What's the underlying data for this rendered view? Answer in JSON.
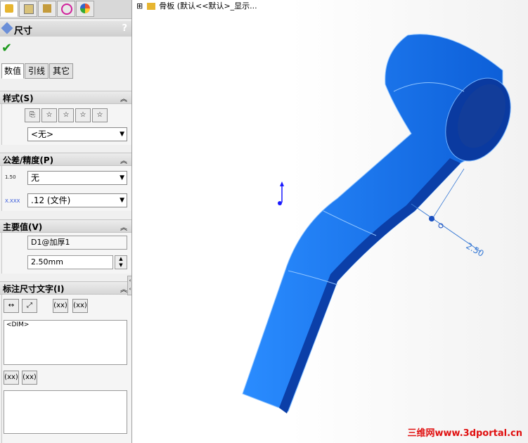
{
  "tree": {
    "expand": "⊞",
    "label": "骨板  (默认<<默认>_显示..."
  },
  "panel": {
    "title": "尺寸",
    "help": "?",
    "subtabs": [
      "数值",
      "引线",
      "其它"
    ],
    "style_section": {
      "title": "样式(S)",
      "select_value": "<无>"
    },
    "tolerance_section": {
      "title": "公差/精度(P)",
      "tolerance_value": "无",
      "precision_value": ".12 (文件)",
      "tol_icon_text": "1.50",
      "prec_icon_text": "X.XXX"
    },
    "primary_section": {
      "title": "主要值(V)",
      "name_value": "D1@加厚1",
      "dim_value": "2.50mm"
    },
    "dimtext_section": {
      "title": "标注尺寸文字(I)",
      "text_value": "<DIM>",
      "btn_xx": "(xx)"
    }
  },
  "viewport": {
    "dimension_label": "2.50"
  },
  "watermark": "三维网www.3dportal.cn",
  "colors": {
    "part": "#1e7cf0",
    "part_dark": "#0b3fa8",
    "accent": "#1e9a1e"
  }
}
